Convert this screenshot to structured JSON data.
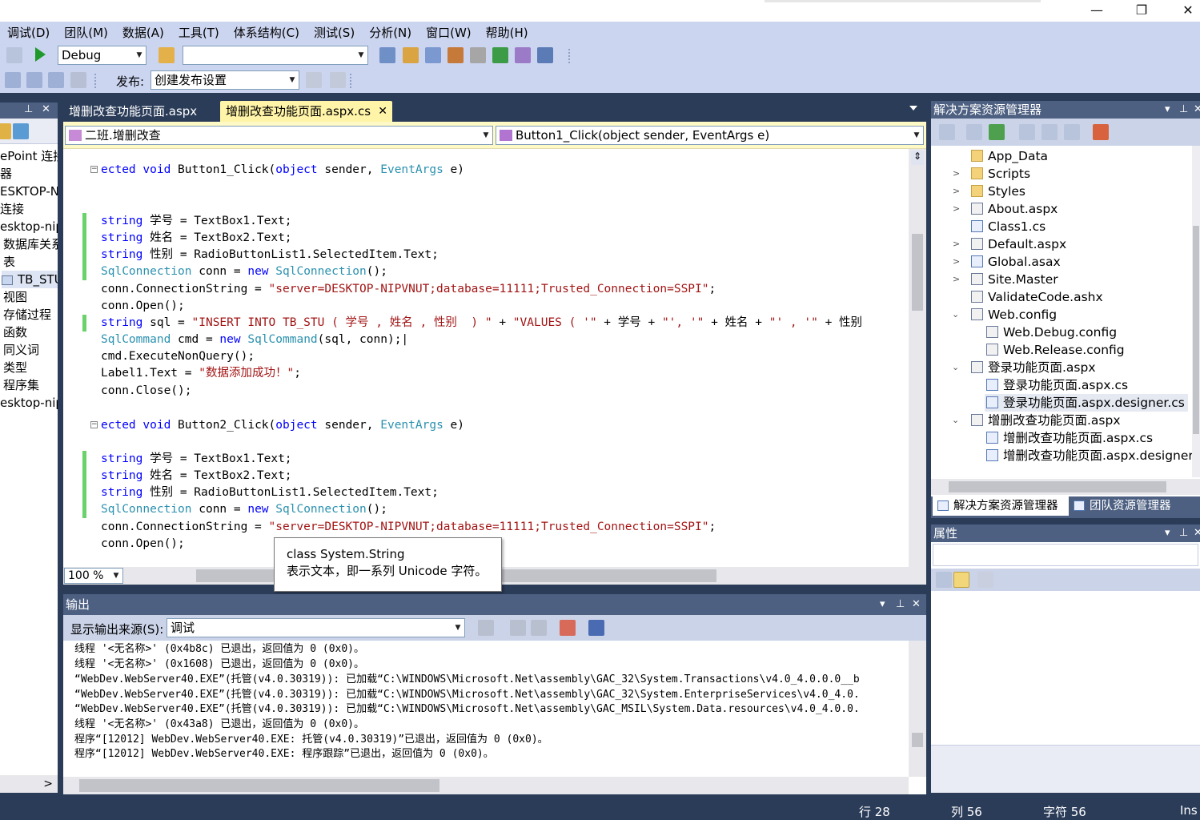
{
  "window": {
    "min": "—",
    "max": "❐",
    "close": "✕"
  },
  "menu": [
    "调试(D)",
    "团队(M)",
    "数据(A)",
    "工具(T)",
    "体系结构(C)",
    "测试(S)",
    "分析(N)",
    "窗口(W)",
    "帮助(H)"
  ],
  "toolbar": {
    "config": "Debug",
    "platform": "",
    "publish_label": "发布:",
    "publish_value": "创建发布设置"
  },
  "left_panel": {
    "items": [
      "ePoint 连接",
      "器",
      "ESKTOP-N",
      "连接",
      "esktop-nip",
      "数据库关系",
      "表",
      "TB_STU",
      "视图",
      "存储过程",
      "函数",
      "同义词",
      "类型",
      "程序集",
      "esktop-nip"
    ]
  },
  "tabs": [
    {
      "label": "增删改查功能页面.aspx",
      "active": false
    },
    {
      "label": "增删改查功能页面.aspx.cs",
      "active": true
    }
  ],
  "nav": {
    "class": "二班.增删改查",
    "member": "Button1_Click(object sender, EventArgs e)"
  },
  "zoom": "100 %",
  "tooltip": {
    "line1": "class System.String",
    "line2": "表示文本，即一系列 Unicode 字符。"
  },
  "output": {
    "title": "输出",
    "source_label": "显示输出来源(S):",
    "source_value": "调试",
    "lines": [
      "线程 '<无名称>' (0x4b8c) 已退出，返回值为 0 (0x0)。",
      "线程 '<无名称>' (0x1608) 已退出，返回值为 0 (0x0)。",
      "“WebDev.WebServer40.EXE”(托管(v4.0.30319)): 已加载“C:\\WINDOWS\\Microsoft.Net\\assembly\\GAC_32\\System.Transactions\\v4.0_4.0.0.0__b",
      "“WebDev.WebServer40.EXE”(托管(v4.0.30319)): 已加载“C:\\WINDOWS\\Microsoft.Net\\assembly\\GAC_32\\System.EnterpriseServices\\v4.0_4.0.",
      "“WebDev.WebServer40.EXE”(托管(v4.0.30319)): 已加载“C:\\WINDOWS\\Microsoft.Net\\assembly\\GAC_MSIL\\System.Data.resources\\v4.0_4.0.0.",
      "线程 '<无名称>' (0x43a8) 已退出，返回值为 0 (0x0)。",
      "程序“[12012] WebDev.WebServer40.EXE: 托管(v4.0.30319)”已退出，返回值为 0 (0x0)。",
      "程序“[12012] WebDev.WebServer40.EXE: 程序跟踪”已退出，返回值为 0 (0x0)。"
    ]
  },
  "solution_explorer": {
    "title": "解决方案资源管理器",
    "items": [
      "App_Data",
      "Scripts",
      "Styles",
      "About.aspx",
      "Class1.cs",
      "Default.aspx",
      "Global.asax",
      "Site.Master",
      "ValidateCode.ashx",
      "Web.config",
      "Web.Debug.config",
      "Web.Release.config",
      "登录功能页面.aspx",
      "登录功能页面.aspx.cs",
      "登录功能页面.aspx.designer.cs",
      "增删改查功能页面.aspx",
      "增删改查功能页面.aspx.cs",
      "增删改查功能页面.aspx.designer.c"
    ],
    "bottom_tabs": [
      "解决方案资源管理器",
      "团队资源管理器"
    ]
  },
  "properties": {
    "title": "属性"
  },
  "status": {
    "line": "行 28",
    "col": "列 56",
    "char": "字符 56",
    "mode": "Ins"
  },
  "colors": {
    "frame": "#2b3c59",
    "menubar": "#ccd5f0",
    "panel_header": "#4d6082",
    "nav_bar": "#fff9c6",
    "keyword": "#0000ff",
    "type": "#2b91af",
    "string": "#a31515",
    "change_mark": "#6ad26a"
  }
}
